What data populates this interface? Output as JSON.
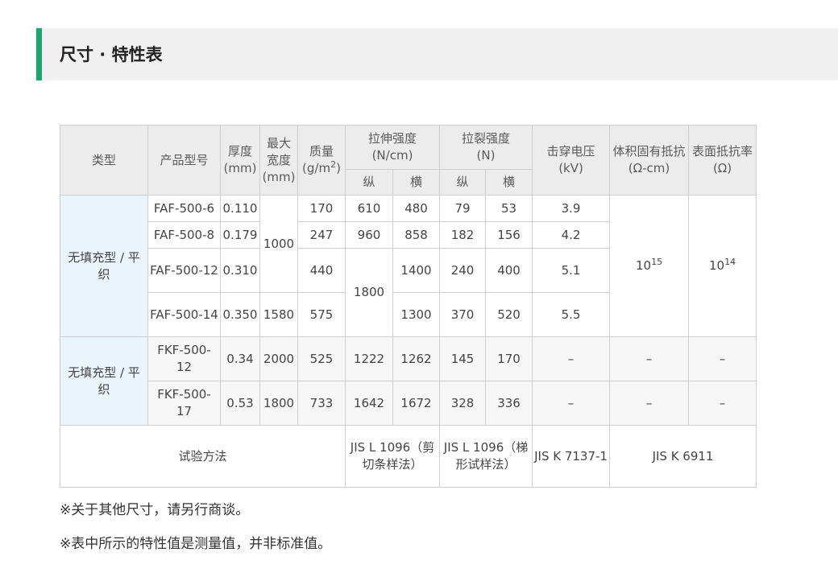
{
  "section": {
    "title": "尺寸 · 特性表"
  },
  "colors": {
    "accent": "#1aa66e",
    "header_bg": "#ececec",
    "type_cell_bg": "#eaf4fb"
  },
  "table": {
    "headers": {
      "type": "类型",
      "model": "产品型号",
      "thickness": "厚度",
      "thickness_unit": "(mm)",
      "max_width": "最大宽度",
      "max_width_unit": "(mm)",
      "mass": "质量",
      "mass_unit_base": "(g/m",
      "mass_unit_exp": "2",
      "mass_unit_close": ")",
      "tensile": "拉伸强度",
      "tensile_unit": "(N/cm)",
      "tear": "拉裂强度",
      "tear_unit": "(N)",
      "breakdown": "击穿电压",
      "breakdown_unit": "(kV)",
      "volume_resistivity": "体积固有抵抗",
      "volume_resistivity_unit": "(Ω-cm)",
      "surface_resistivity": "表面抵抗率",
      "surface_resistivity_unit": "(Ω)",
      "longitudinal": "纵",
      "transverse": "横"
    },
    "group_a": {
      "type": "无填充型 / 平织",
      "shared_width": "1000",
      "shared_tensile_long": "1800",
      "volume_base": "10",
      "volume_exp": "15",
      "surface_base": "10",
      "surface_exp": "14",
      "rows": [
        {
          "model": "FAF-500-6",
          "thickness": "0.110",
          "mass": "170",
          "tensile_long": "610",
          "tensile_trans": "480",
          "tear_long": "79",
          "tear_trans": "53",
          "breakdown": "3.9"
        },
        {
          "model": "FAF-500-8",
          "thickness": "0.179",
          "mass": "247",
          "tensile_long": "960",
          "tensile_trans": "858",
          "tear_long": "182",
          "tear_trans": "156",
          "breakdown": "4.2"
        },
        {
          "model": "FAF-500-12",
          "thickness": "0.310",
          "mass": "440",
          "tensile_trans": "1400",
          "tear_long": "240",
          "tear_trans": "400",
          "breakdown": "5.1"
        },
        {
          "model": "FAF-500-14",
          "thickness": "0.350",
          "width": "1580",
          "mass": "575",
          "tensile_trans": "1300",
          "tear_long": "370",
          "tear_trans": "520",
          "breakdown": "5.5"
        }
      ]
    },
    "group_b": {
      "type": "无填充型 / 平织",
      "rows": [
        {
          "model": "FKF-500-12",
          "thickness": "0.34",
          "width": "2000",
          "mass": "525",
          "tensile_long": "1222",
          "tensile_trans": "1262",
          "tear_long": "145",
          "tear_trans": "170",
          "breakdown": "–",
          "volume": "–",
          "surface": "–"
        },
        {
          "model": "FKF-500-17",
          "thickness": "0.53",
          "width": "1800",
          "mass": "733",
          "tensile_long": "1642",
          "tensile_trans": "1672",
          "tear_long": "328",
          "tear_trans": "336",
          "breakdown": "–",
          "volume": "–",
          "surface": "–"
        }
      ]
    },
    "method_row": {
      "label": "试验方法",
      "tensile": "JIS L 1096（剪切条样法）",
      "tear": "JIS L 1096（梯形试样法）",
      "breakdown": "JIS K 7137-1",
      "resistivity": "JIS K 6911"
    }
  },
  "notes": [
    "※关于其他尺寸，请另行商谈。",
    "※表中所示的特性值是测量值，并非标准值。"
  ]
}
